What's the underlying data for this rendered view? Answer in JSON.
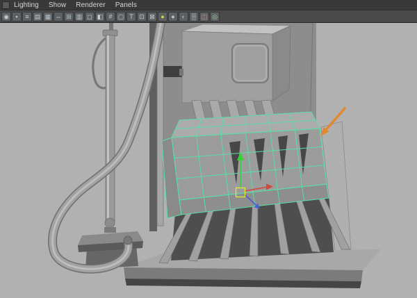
{
  "menu_bar": {
    "items": [
      "Lighting",
      "Show",
      "Renderer",
      "Panels"
    ]
  },
  "toolbar": {
    "icons": [
      {
        "name": "select-camera-icon",
        "glyph": "◉",
        "color": "#c9ced1"
      },
      {
        "name": "lock-camera-icon",
        "glyph": "▪",
        "color": "#c9ced1"
      },
      {
        "name": "camera-attributes-icon",
        "glyph": "≡",
        "color": "#c9ced1"
      },
      {
        "name": "bookmarks-icon",
        "glyph": "▤",
        "color": "#c9ced1"
      },
      {
        "name": "image-plane-icon",
        "glyph": "▦",
        "color": "#b9c4cc"
      },
      {
        "name": "pan-zoom-icon",
        "glyph": "⇔",
        "color": "#c9ced1"
      },
      {
        "name": "grid-icon",
        "glyph": "⊞",
        "color": "#aebdc6"
      },
      {
        "name": "film-gate-icon",
        "glyph": "▥",
        "color": "#c9ced1"
      },
      {
        "name": "resolution-gate-icon",
        "glyph": "◻",
        "color": "#c9ced1"
      },
      {
        "name": "gate-mask-icon",
        "glyph": "◧",
        "color": "#c9ced1"
      },
      {
        "name": "field-chart-icon",
        "glyph": "#",
        "color": "#c9ced1"
      },
      {
        "name": "safe-action-icon",
        "glyph": "▢",
        "color": "#c9ced1"
      },
      {
        "name": "safe-title-icon",
        "glyph": "T",
        "color": "#c9ced1"
      },
      {
        "name": "frame-all-icon",
        "glyph": "⊡",
        "color": "#c9ced1"
      },
      {
        "name": "frame-selection-icon",
        "glyph": "⊠",
        "color": "#c9ced1"
      },
      {
        "name": "default-lighting-icon",
        "glyph": "●",
        "color": "#cdd34e"
      },
      {
        "name": "all-lights-icon",
        "glyph": "●",
        "color": "#c2c2c2"
      },
      {
        "name": "shadows-icon",
        "glyph": "◐",
        "color": "#9fa8ad"
      },
      {
        "name": "xray-icon",
        "glyph": "▒",
        "color": "#c9ced1"
      },
      {
        "name": "wireframe-on-shaded-icon",
        "glyph": "◫",
        "color": "#cf8f8f"
      },
      {
        "name": "isolate-select-icon",
        "glyph": "◎",
        "color": "#9fd08f"
      }
    ]
  },
  "viewport": {
    "colors": {
      "background": "#b1b1b1",
      "selection_wireframe": "#58dfa6",
      "manipulator_x": "#cf4a3a",
      "manipulator_y": "#35d435",
      "manipulator_z": "#4a5fd4",
      "manipulator_center": "#e6e638",
      "annotation_arrow": "#e0892f"
    }
  }
}
